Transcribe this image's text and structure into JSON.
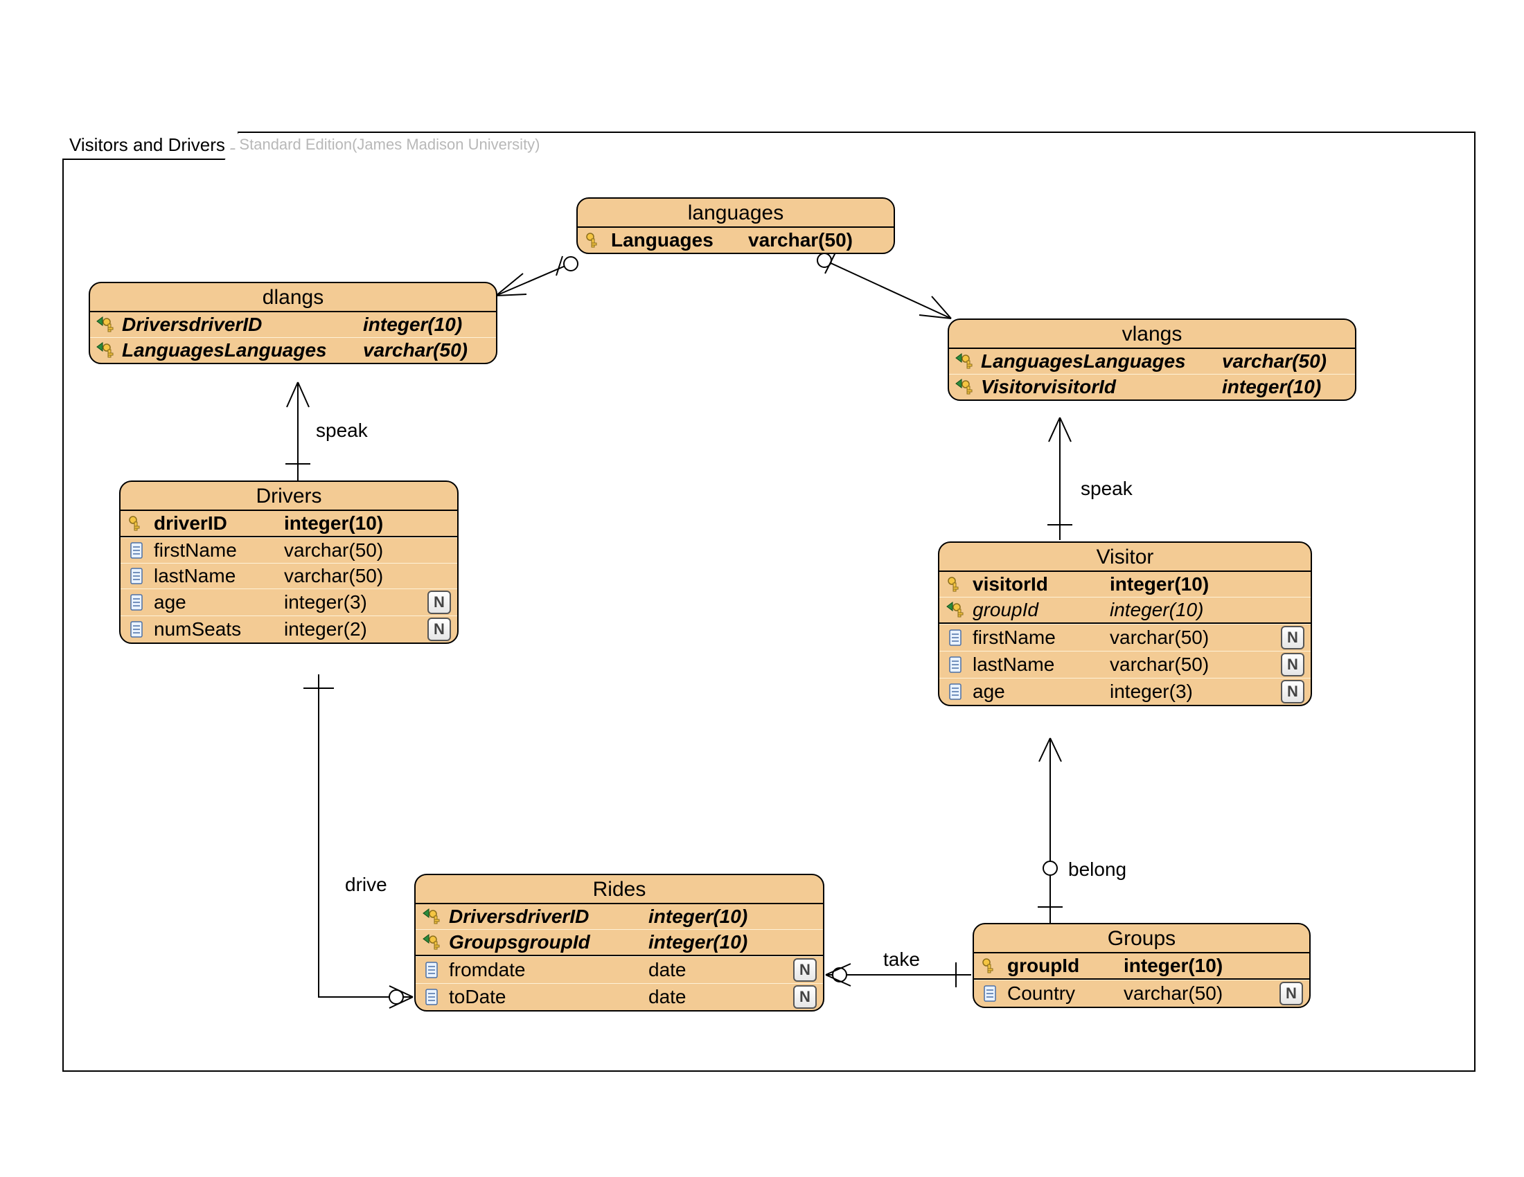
{
  "watermark": "Visual Paradigm for UML Standard Edition(James Madison University)",
  "frame": {
    "title": "Visitors and Drivers"
  },
  "relations": {
    "dlangs_drivers": "speak",
    "vlangs_visitor": "speak",
    "drivers_rides": "drive",
    "rides_groups": "take",
    "visitor_groups": "belong"
  },
  "entities": {
    "languages": {
      "title": "languages",
      "rows": [
        {
          "icon": "pk",
          "name": "Languages",
          "type": "varchar(50)",
          "bold": true
        }
      ]
    },
    "dlangs": {
      "title": "dlangs",
      "rows": [
        {
          "icon": "fk",
          "name": "DriversdriverID",
          "type": "integer(10)",
          "bold": true,
          "italic": true
        },
        {
          "icon": "fk",
          "name": "LanguagesLanguages",
          "type": "varchar(50)",
          "bold": true,
          "italic": true
        }
      ]
    },
    "vlangs": {
      "title": "vlangs",
      "rows": [
        {
          "icon": "fk",
          "name": "LanguagesLanguages",
          "type": "varchar(50)",
          "bold": true,
          "italic": true
        },
        {
          "icon": "fk",
          "name": "VisitorvisitorId",
          "type": "integer(10)",
          "bold": true,
          "italic": true
        }
      ]
    },
    "drivers": {
      "title": "Drivers",
      "rows": [
        {
          "icon": "pk",
          "name": "driverID",
          "type": "integer(10)",
          "bold": true
        },
        {
          "icon": "col",
          "name": "firstName",
          "type": "varchar(50)"
        },
        {
          "icon": "col",
          "name": "lastName",
          "type": "varchar(50)"
        },
        {
          "icon": "col",
          "name": "age",
          "type": "integer(3)",
          "nullable": true
        },
        {
          "icon": "col",
          "name": "numSeats",
          "type": "integer(2)",
          "nullable": true
        }
      ]
    },
    "visitor": {
      "title": "Visitor",
      "rows": [
        {
          "icon": "pk",
          "name": "visitorId",
          "type": "integer(10)",
          "bold": true
        },
        {
          "icon": "fk",
          "name": "groupId",
          "type": "integer(10)",
          "italic": true
        },
        {
          "icon": "col",
          "name": "firstName",
          "type": "varchar(50)",
          "nullable": true
        },
        {
          "icon": "col",
          "name": "lastName",
          "type": "varchar(50)",
          "nullable": true
        },
        {
          "icon": "col",
          "name": "age",
          "type": "integer(3)",
          "nullable": true
        }
      ]
    },
    "rides": {
      "title": "Rides",
      "rows": [
        {
          "icon": "fk",
          "name": "DriversdriverID",
          "type": "integer(10)",
          "bold": true,
          "italic": true
        },
        {
          "icon": "fk",
          "name": "GroupsgroupId",
          "type": "integer(10)",
          "bold": true,
          "italic": true
        },
        {
          "icon": "col",
          "name": "fromdate",
          "type": "date",
          "nullable": true
        },
        {
          "icon": "col",
          "name": "toDate",
          "type": "date",
          "nullable": true
        }
      ]
    },
    "groups": {
      "title": "Groups",
      "rows": [
        {
          "icon": "pk",
          "name": "groupId",
          "type": "integer(10)",
          "bold": true
        },
        {
          "icon": "col",
          "name": "Country",
          "type": "varchar(50)",
          "nullable": true
        }
      ]
    }
  }
}
